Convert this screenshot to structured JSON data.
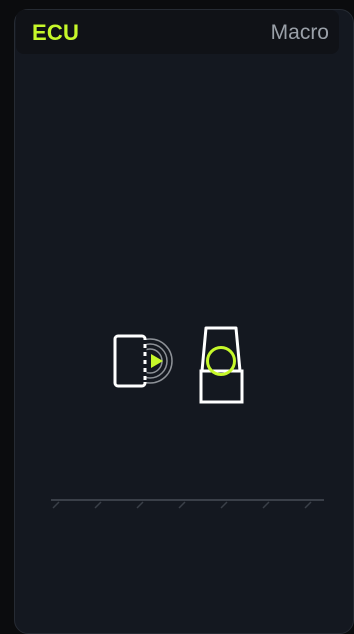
{
  "header": {
    "title": "ECU",
    "mode_label": "Macro"
  },
  "icons": {
    "left": "door-nfc-reader-icon",
    "right": "ecu-module-icon",
    "scale": "ruler-scale-icon"
  },
  "colors": {
    "accent": "#c6f82a",
    "panel_bg": "#141820",
    "header_bg": "#101217",
    "mode_text": "#9aa0a8",
    "outline": "#ffffff"
  }
}
